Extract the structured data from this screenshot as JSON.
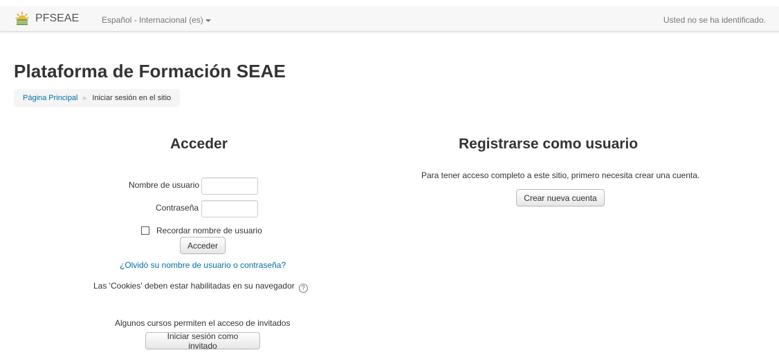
{
  "navbar": {
    "brand": "PFSEAE",
    "language": "Español - Internacional (es)",
    "login_info": "Usted no se ha identificado."
  },
  "page": {
    "title": "Plataforma de Formación SEAE"
  },
  "breadcrumb": {
    "home": "Página Principal",
    "current": "Iniciar sesión en el sitio"
  },
  "login": {
    "heading": "Acceder",
    "username_label": "Nombre de usuario",
    "username_value": "",
    "password_label": "Contraseña",
    "password_value": "",
    "remember_label": "Recordar nombre de usuario",
    "remember_checked": false,
    "submit": "Acceder",
    "forgot_link": "¿Olvidó su nombre de usuario o contraseña?",
    "cookies_notice": "Las 'Cookies' deben estar habilitadas en su navegador",
    "guest_notice": "Algunos cursos permiten el acceso de invitados",
    "guest_button": "Iniciar sesión como invitado"
  },
  "signup": {
    "heading": "Registrarse como usuario",
    "description": "Para tener acceso completo a este sitio, primero necesita crear una cuenta.",
    "button": "Crear nueva cuenta"
  },
  "icons": {
    "logo": "sun-emblem-logo",
    "help": "question-circle-icon",
    "caret": "caret-down-icon"
  },
  "colors": {
    "link": "#0070a8",
    "navbar_bg": "#f7f7f7",
    "breadcrumb_bg": "#f5f5f5"
  }
}
